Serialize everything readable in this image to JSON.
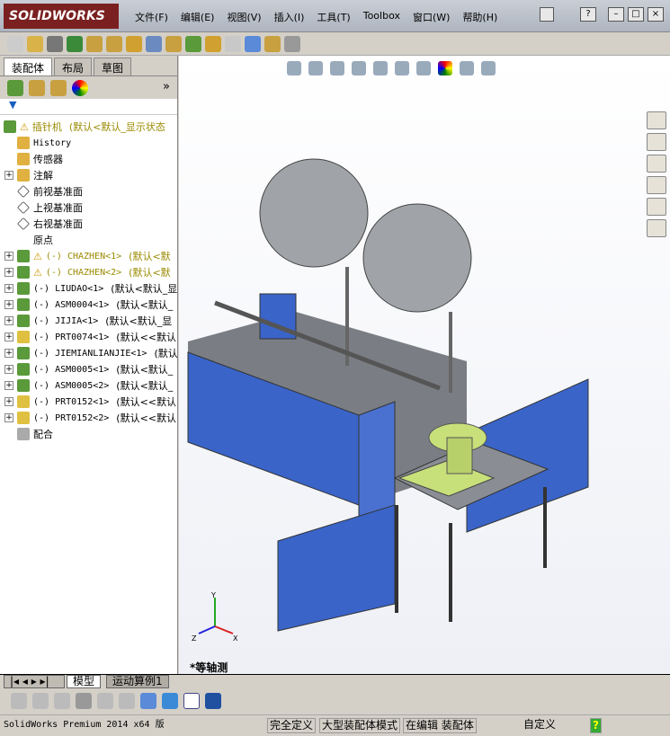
{
  "app": {
    "logo": "SOLIDWORKS"
  },
  "menu": [
    "文件(F)",
    "编辑(E)",
    "视图(V)",
    "插入(I)",
    "工具(T)",
    "Toolbox",
    "窗口(W)",
    "帮助(H)"
  ],
  "panel": {
    "tabs": [
      "装配体",
      "布局",
      "草图"
    ],
    "tree": [
      {
        "label": "插针机",
        "config": "(默认<默认_显示状态",
        "warn": true,
        "kind": "root"
      },
      {
        "label": "History",
        "kind": "history"
      },
      {
        "label": "传感器",
        "kind": "sensor"
      },
      {
        "label": "注解",
        "kind": "annotation",
        "exp": true
      },
      {
        "label": "前视基准面",
        "kind": "plane"
      },
      {
        "label": "上视基准面",
        "kind": "plane"
      },
      {
        "label": "右视基准面",
        "kind": "plane"
      },
      {
        "label": "原点",
        "kind": "origin"
      },
      {
        "label": "(-) CHAZHEN<1>",
        "config": "(默认<默",
        "warn": true,
        "kind": "asm",
        "exp": true
      },
      {
        "label": "(-) CHAZHEN<2>",
        "config": "(默认<默",
        "warn": true,
        "kind": "asm",
        "exp": true
      },
      {
        "label": "(-) LIUDAO<1>",
        "config": "(默认<默认_显",
        "kind": "asm",
        "exp": true
      },
      {
        "label": "(-) ASM0004<1>",
        "config": "(默认<默认_",
        "kind": "asm",
        "exp": true
      },
      {
        "label": "(-) JIJIA<1>",
        "config": "(默认<默认_显",
        "kind": "asm",
        "exp": true
      },
      {
        "label": "(-) PRT0074<1>",
        "config": "(默认<<默认",
        "kind": "part",
        "exp": true
      },
      {
        "label": "(-) JIEMIANLIANJIE<1>",
        "config": "(默认",
        "kind": "asm",
        "exp": true
      },
      {
        "label": "(-) ASM0005<1>",
        "config": "(默认<默认_",
        "kind": "asm",
        "exp": true
      },
      {
        "label": "(-) ASM0005<2>",
        "config": "(默认<默认_",
        "kind": "asm",
        "exp": true
      },
      {
        "label": "(-) PRT0152<1>",
        "config": "(默认<<默认",
        "kind": "part",
        "exp": true
      },
      {
        "label": "(-) PRT0152<2>",
        "config": "(默认<<默认",
        "kind": "part",
        "exp": true
      },
      {
        "label": "配合",
        "kind": "mates"
      }
    ]
  },
  "viewport": {
    "view_label": "*等轴测",
    "triad": {
      "x": "X",
      "y": "Y",
      "z": "Z"
    }
  },
  "bottom_tabs": [
    "模型",
    "运动算例1"
  ],
  "status": {
    "product": "SolidWorks Premium 2014 x64 版",
    "s1": "完全定义",
    "s2": "大型装配体模式",
    "s3": "在编辑 装配体",
    "units": "自定义"
  },
  "colors": {
    "machine_blue": "#3a64c8",
    "bowl": "#c8e07a",
    "frame": "#555a60"
  }
}
